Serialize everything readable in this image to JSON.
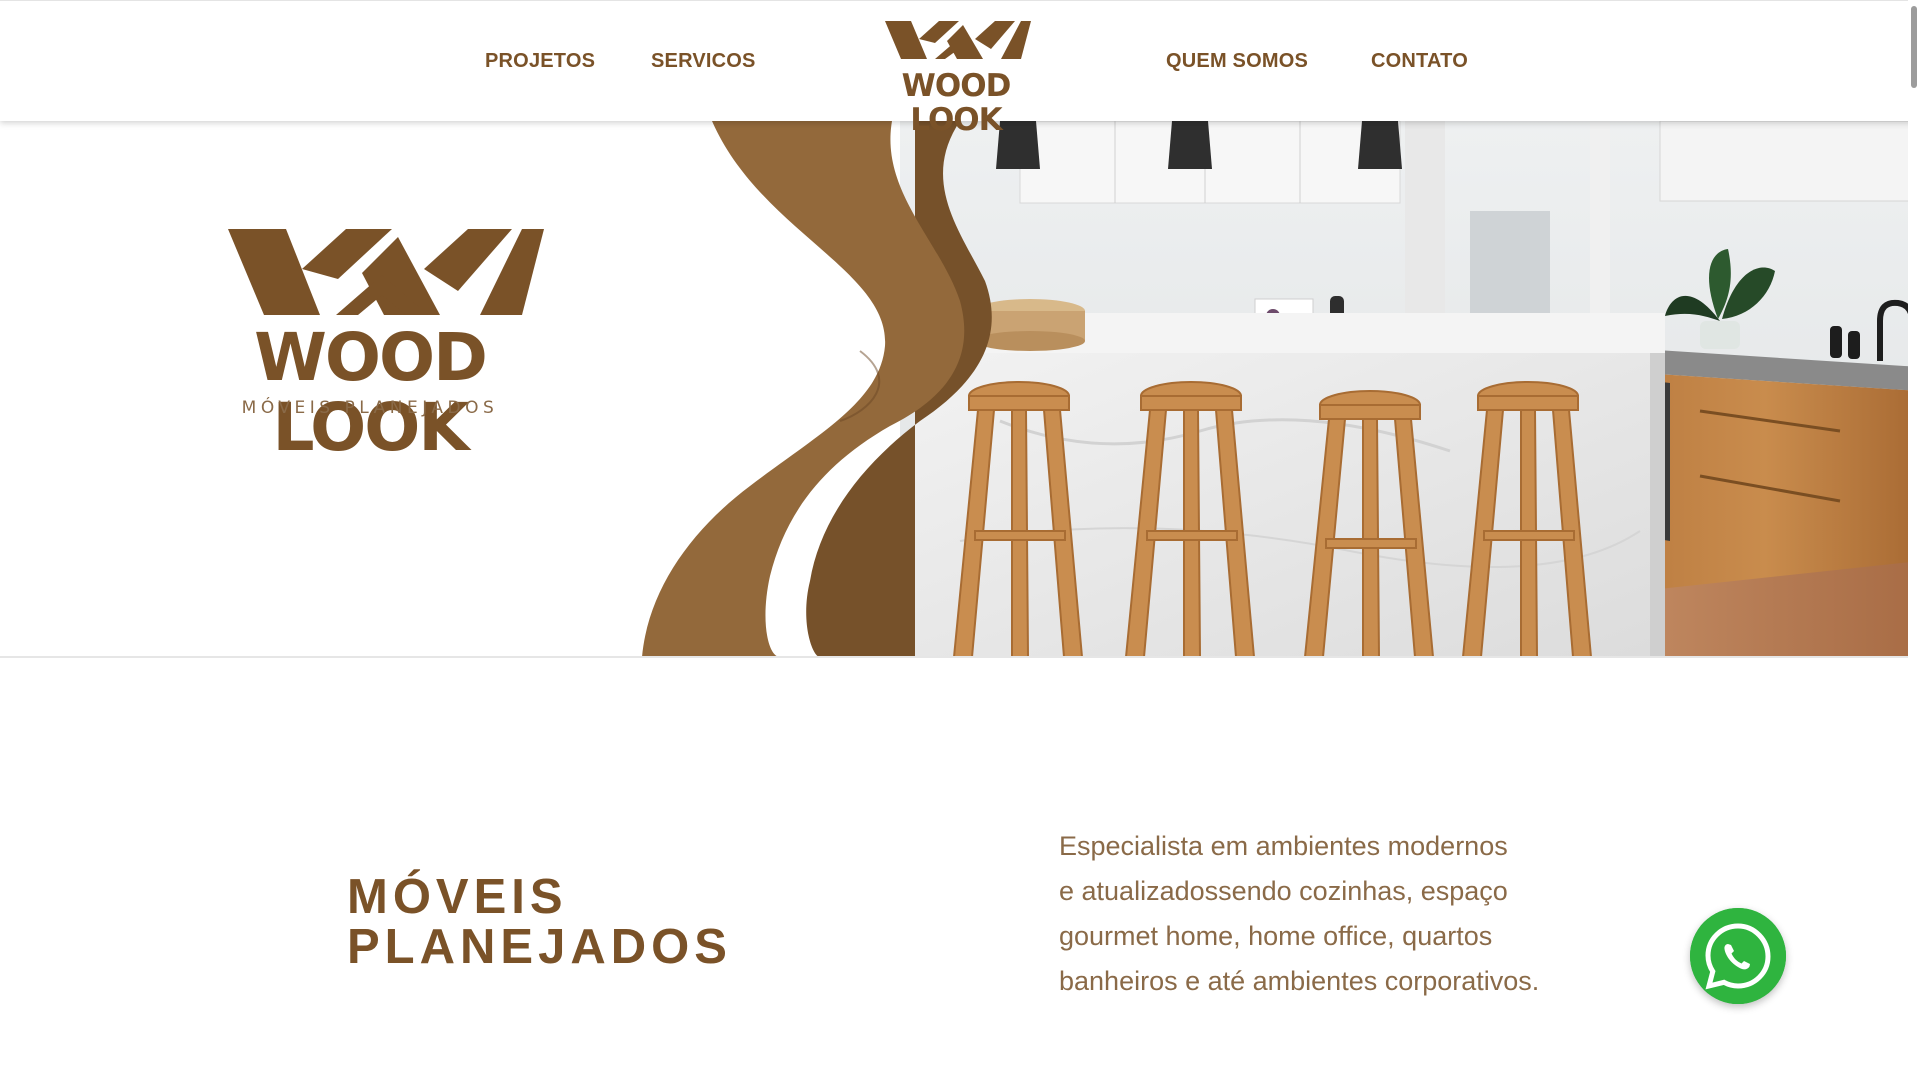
{
  "header": {
    "nav_left": [
      "PROJETOS",
      "SERVICOS"
    ],
    "nav_right": [
      "QUEM SOMOS",
      "CONTATO"
    ],
    "logo_text": "WOOD LOOK"
  },
  "hero": {
    "brand": "WOOD LOOK",
    "tagline": "MÓVEIS PLANEJADOS"
  },
  "section": {
    "heading_lines": [
      "MÓVEIS",
      "PLANEJADOS"
    ],
    "description_lines": [
      "Especialista em ambientes modernos",
      "e atualizadossendo cozinhas, espaço",
      "gourmet home, home office, quartos",
      "banheiros e até ambientes corporativos."
    ]
  },
  "whatsapp": {
    "icon": "whatsapp-icon"
  },
  "colors": {
    "brand_brown": "#7a5228",
    "text_brown": "#8a6a48",
    "whatsapp_green": "#2fb43f",
    "wave_light": "#93693b",
    "wave_dark": "#76512a"
  }
}
